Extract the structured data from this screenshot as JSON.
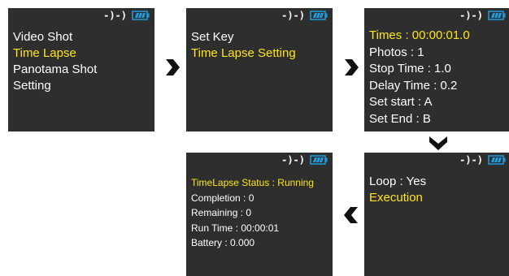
{
  "status": {
    "signal_glyph": "-)-)",
    "battery_icon": "battery-full-icon",
    "battery_color": "#1f9ee0"
  },
  "screens": {
    "main_menu": {
      "items": [
        "Video Shot",
        "Time Lapse",
        "Panotama Shot",
        "Setting"
      ],
      "selected_index": 1
    },
    "time_lapse_menu": {
      "items": [
        "Set Key",
        "Time Lapse Setting"
      ],
      "selected_index": 1
    },
    "time_lapse_setting": {
      "items": [
        "Times : 00:00:01.0",
        "Photos : 1",
        "Stop Time : 1.0",
        "Delay Time : 0.2",
        "Set start : A",
        "Set End : B"
      ],
      "selected_index": 0
    },
    "execution_menu": {
      "items": [
        "Loop : Yes",
        "Execution"
      ],
      "selected_index": 1
    },
    "status_screen": {
      "items": [
        "TimeLapse Status : Running",
        "Completion : 0",
        "Remaining : 0",
        "Run Time : 00:00:01",
        "Battery : 0.000"
      ],
      "selected_index": 0
    }
  },
  "colors": {
    "screen_bg": "#2e2e2e",
    "text": "#ffffff",
    "highlight": "#ffe51a",
    "arrow": "#111111"
  },
  "flow_icons": [
    "arrow-right-icon",
    "arrow-right-icon",
    "arrow-down-icon",
    "arrow-left-icon"
  ]
}
